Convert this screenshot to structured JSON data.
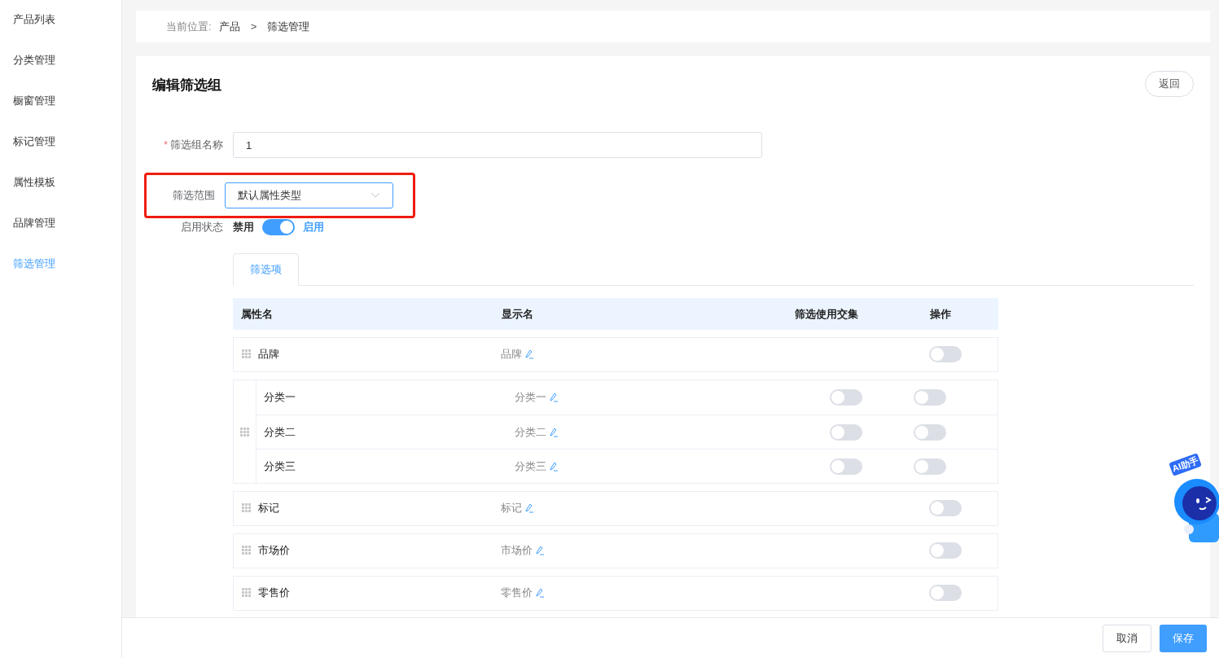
{
  "sidebar": {
    "items": [
      {
        "label": "产品列表",
        "selected": false
      },
      {
        "label": "分类管理",
        "selected": false
      },
      {
        "label": "橱窗管理",
        "selected": false
      },
      {
        "label": "标记管理",
        "selected": false
      },
      {
        "label": "属性模板",
        "selected": false
      },
      {
        "label": "品牌管理",
        "selected": false
      },
      {
        "label": "筛选管理",
        "selected": true
      }
    ]
  },
  "breadcrumb": {
    "prefix": "当前位置:",
    "items": [
      "产品",
      "筛选管理"
    ],
    "separator": ">"
  },
  "page": {
    "title": "编辑筛选组",
    "back_button": "返回"
  },
  "form": {
    "name": {
      "label": "筛选组名称",
      "required_mark": "*",
      "value": "1"
    },
    "scope": {
      "label": "筛选范围",
      "value": "默认属性类型",
      "highlighted": true
    },
    "status": {
      "label": "启用状态",
      "off_label": "禁用",
      "on_label": "启用",
      "on": true
    }
  },
  "tabs": [
    {
      "label": "筛选项",
      "selected": true
    }
  ],
  "table": {
    "columns": [
      "属性名",
      "显示名",
      "筛选使用交集",
      "操作"
    ],
    "rows": [
      {
        "kind": "single",
        "name": "品牌",
        "display": "品牌",
        "enabled": false
      },
      {
        "kind": "group",
        "children": [
          {
            "name": "分类一",
            "display": "分类一",
            "intersection": false,
            "enabled": false
          },
          {
            "name": "分类二",
            "display": "分类二",
            "intersection": false,
            "enabled": false
          },
          {
            "name": "分类三",
            "display": "分类三",
            "intersection": false,
            "enabled": false
          }
        ]
      },
      {
        "kind": "single",
        "name": "标记",
        "display": "标记",
        "enabled": false
      },
      {
        "kind": "single",
        "name": "市场价",
        "display": "市场价",
        "enabled": false
      },
      {
        "kind": "single",
        "name": "零售价",
        "display": "零售价",
        "enabled": false
      }
    ]
  },
  "assistant": {
    "label": "AI助手"
  },
  "footer": {
    "cancel": "取消",
    "save": "保存"
  }
}
